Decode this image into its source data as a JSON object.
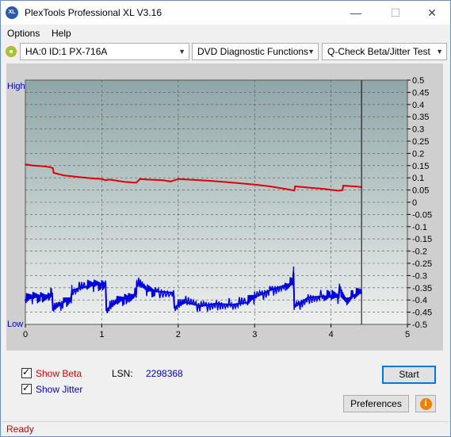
{
  "window": {
    "title": "PlexTools Professional XL V3.16",
    "icon_label": "XL",
    "controls": {
      "minimize": "—",
      "maximize": "☐",
      "close": "✕"
    }
  },
  "menu": {
    "options": "Options",
    "help": "Help"
  },
  "toolbar": {
    "drive": "HA:0 ID:1  PX-716A",
    "function": "DVD Diagnostic Functions",
    "test": "Q-Check Beta/Jitter Test"
  },
  "chart_data": {
    "type": "line",
    "left_axis_labels": {
      "top": "High",
      "bottom": "Low"
    },
    "x_ticks": [
      "0",
      "1",
      "2",
      "3",
      "4",
      "5"
    ],
    "xlim": [
      0,
      5
    ],
    "ylim": [
      -0.5,
      0.5
    ],
    "y_ticks": [
      "0.5",
      "0.45",
      "0.4",
      "0.35",
      "0.3",
      "0.25",
      "0.2",
      "0.15",
      "0.1",
      "0.05",
      "0",
      "-0.05",
      "-0.1",
      "-0.15",
      "-0.2",
      "-0.25",
      "-0.3",
      "-0.35",
      "-0.4",
      "-0.45",
      "-0.5"
    ],
    "grid": true,
    "cursor_x": 4.4,
    "series": [
      {
        "color": "#e00000",
        "x": [
          0.0,
          0.1,
          0.2,
          0.3,
          0.36,
          0.37,
          0.5,
          0.7,
          0.9,
          1.0,
          1.05,
          1.1,
          1.2,
          1.3,
          1.45,
          1.5,
          1.6,
          1.8,
          1.9,
          2.0,
          2.2,
          2.4,
          2.6,
          2.8,
          3.0,
          3.2,
          3.4,
          3.52,
          3.53,
          3.7,
          3.9,
          4.1,
          4.15,
          4.16,
          4.3,
          4.4
        ],
        "y": [
          0.155,
          0.15,
          0.148,
          0.145,
          0.14,
          0.12,
          0.11,
          0.103,
          0.097,
          0.095,
          0.09,
          0.093,
          0.088,
          0.083,
          0.08,
          0.095,
          0.093,
          0.09,
          0.085,
          0.095,
          0.092,
          0.088,
          0.083,
          0.078,
          0.072,
          0.065,
          0.055,
          0.048,
          0.065,
          0.06,
          0.055,
          0.047,
          0.05,
          0.068,
          0.065,
          0.062
        ]
      },
      {
        "color": "#0000e0",
        "x": [
          0.0,
          0.1,
          0.2,
          0.3,
          0.35,
          0.36,
          0.5,
          0.6,
          0.61,
          0.8,
          0.9,
          1.0,
          1.05,
          1.06,
          1.2,
          1.3,
          1.35,
          1.45,
          1.46,
          1.6,
          1.7,
          1.94,
          1.95,
          2.1,
          2.3,
          2.5,
          2.7,
          2.9,
          3.0,
          3.2,
          3.4,
          3.5,
          3.51,
          3.52,
          3.7,
          3.9,
          4.0,
          4.1,
          4.11,
          4.2,
          4.3,
          4.4
        ],
        "y": [
          -0.4,
          -0.39,
          -0.385,
          -0.38,
          -0.375,
          -0.44,
          -0.41,
          -0.39,
          -0.36,
          -0.345,
          -0.34,
          -0.335,
          -0.33,
          -0.44,
          -0.41,
          -0.395,
          -0.385,
          -0.375,
          -0.33,
          -0.36,
          -0.365,
          -0.37,
          -0.43,
          -0.41,
          -0.425,
          -0.415,
          -0.42,
          -0.41,
          -0.39,
          -0.36,
          -0.34,
          -0.33,
          -0.29,
          -0.43,
          -0.39,
          -0.385,
          -0.385,
          -0.39,
          -0.35,
          -0.4,
          -0.38,
          -0.37
        ]
      }
    ]
  },
  "controls": {
    "show_beta": "Show Beta",
    "show_jitter": "Show Jitter",
    "lsn_label": "LSN:",
    "lsn_value": "2298368",
    "start": "Start",
    "preferences": "Preferences",
    "info_icon": "i"
  },
  "status": {
    "text": "Ready"
  }
}
